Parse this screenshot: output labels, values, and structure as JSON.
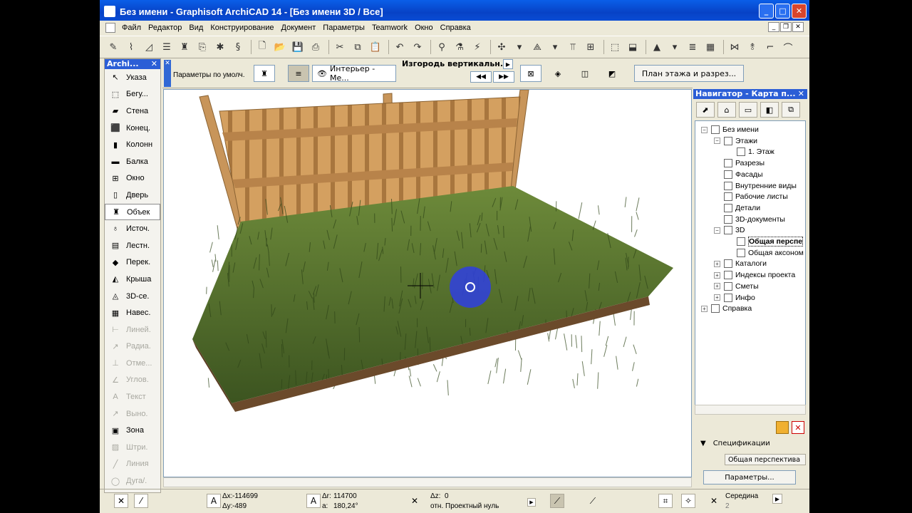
{
  "window": {
    "title": "Без имени - Graphisoft ArchiCAD 14 - [Без имени 3D / Все]"
  },
  "menubar": {
    "items": [
      "Файл",
      "Редактор",
      "Вид",
      "Конструирование",
      "Документ",
      "Параметры",
      "Teamwork",
      "Окно",
      "Справка"
    ]
  },
  "toolbox": {
    "title": "Archi...",
    "items": [
      {
        "label": "Указа",
        "icon": "pointer-icon",
        "state": "normal"
      },
      {
        "label": "Бегу...",
        "icon": "marquee-icon",
        "state": "normal"
      },
      {
        "label": "Стена",
        "icon": "wall-icon",
        "state": "normal"
      },
      {
        "label": "Конец.",
        "icon": "column-end-icon",
        "state": "normal"
      },
      {
        "label": "Колонн",
        "icon": "column-icon",
        "state": "normal"
      },
      {
        "label": "Балка",
        "icon": "beam-icon",
        "state": "normal"
      },
      {
        "label": "Окно",
        "icon": "window-icon",
        "state": "normal"
      },
      {
        "label": "Дверь",
        "icon": "door-icon",
        "state": "normal"
      },
      {
        "label": "Объек",
        "icon": "object-icon",
        "state": "active"
      },
      {
        "label": "Источ.",
        "icon": "lamp-icon",
        "state": "normal"
      },
      {
        "label": "Лестн.",
        "icon": "stair-icon",
        "state": "normal"
      },
      {
        "label": "Перек.",
        "icon": "slab-icon",
        "state": "normal"
      },
      {
        "label": "Крыша",
        "icon": "roof-icon",
        "state": "normal"
      },
      {
        "label": "3D-се.",
        "icon": "mesh-icon",
        "state": "normal"
      },
      {
        "label": "Навес.",
        "icon": "curtain-wall-icon",
        "state": "normal"
      },
      {
        "label": "Линей.",
        "icon": "linear-dimension-icon",
        "state": "disabled"
      },
      {
        "label": "Радиа.",
        "icon": "radial-dimension-icon",
        "state": "disabled"
      },
      {
        "label": "Отме...",
        "icon": "level-dimension-icon",
        "state": "disabled"
      },
      {
        "label": "Углов.",
        "icon": "angle-dimension-icon",
        "state": "disabled"
      },
      {
        "label": "Текст",
        "icon": "text-icon",
        "state": "disabled"
      },
      {
        "label": "Выно.",
        "icon": "label-icon",
        "state": "disabled"
      },
      {
        "label": "Зона",
        "icon": "zone-icon",
        "state": "normal"
      },
      {
        "label": "Штри.",
        "icon": "fill-icon",
        "state": "disabled"
      },
      {
        "label": "Линия",
        "icon": "line-icon",
        "state": "disabled"
      },
      {
        "label": "Дуга/.",
        "icon": "arc-icon",
        "state": "disabled"
      }
    ]
  },
  "infobox": {
    "default_params": "Параметры по умолч.",
    "layer_btn": "Интерьер - Ме...",
    "object_name": "Изгородь вертикальн...",
    "plan_btn": "План этажа и разрез..."
  },
  "navigator": {
    "title": "Навигатор - Карта п...",
    "tree": [
      {
        "label": "Без имени",
        "level": 0,
        "expander": "minus"
      },
      {
        "label": "Этажи",
        "level": 1,
        "expander": "minus"
      },
      {
        "label": "1. Этаж",
        "level": 2,
        "expander": ""
      },
      {
        "label": "Разрезы",
        "level": 1,
        "expander": ""
      },
      {
        "label": "Фасады",
        "level": 1,
        "expander": ""
      },
      {
        "label": "Внутренние виды",
        "level": 1,
        "expander": ""
      },
      {
        "label": "Рабочие листы",
        "level": 1,
        "expander": ""
      },
      {
        "label": "Детали",
        "level": 1,
        "expander": ""
      },
      {
        "label": "3D-документы",
        "level": 1,
        "expander": ""
      },
      {
        "label": "3D",
        "level": 1,
        "expander": "minus"
      },
      {
        "label": "Общая перспе",
        "level": 2,
        "expander": "",
        "selected": true
      },
      {
        "label": "Общая аксоном",
        "level": 2,
        "expander": ""
      },
      {
        "label": "Каталоги",
        "level": 1,
        "expander": "plus"
      },
      {
        "label": "Индексы проекта",
        "level": 1,
        "expander": "plus"
      },
      {
        "label": "Сметы",
        "level": 1,
        "expander": "plus"
      },
      {
        "label": "Инфо",
        "level": 1,
        "expander": "plus"
      },
      {
        "label": "Справка",
        "level": 0,
        "expander": "plus"
      }
    ],
    "spec_label": "Спецификации",
    "spec_value": "Общая перспектива",
    "params_btn": "Параметры..."
  },
  "status": {
    "dx_label": "Δx:",
    "dx_value": "-114699",
    "dy_label": "Δy:",
    "dy_value": "-489",
    "dr_label": "Δr:",
    "dr_value": "114700",
    "a_label": "a:",
    "a_value": "180,24°",
    "dz_label": "Δz:",
    "dz_value": "0",
    "ref_label": "отн. Проектный нуль",
    "snap_label": "Середина",
    "snap_count": "2"
  },
  "colors": {
    "title_blue": "#0742c6",
    "palette_head": "#2b5ed6",
    "grass": "#4d6b2a",
    "fence": "#c8955a",
    "soil": "#6b4a2b",
    "cursor_blue": "#2f3fe0"
  }
}
